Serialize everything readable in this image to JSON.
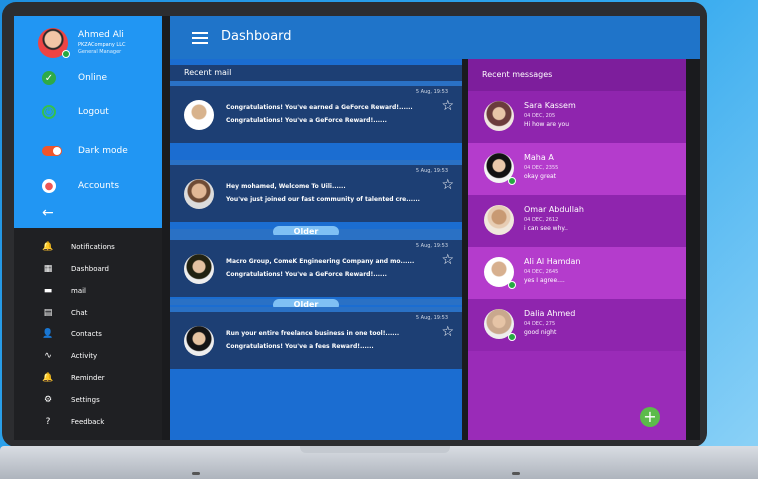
{
  "header": {
    "title": "Dashboard"
  },
  "user": {
    "name": "Ahmed Ali",
    "company": "PKZACompany LLC",
    "role": "General Manager"
  },
  "top_menu": [
    {
      "label": "Online",
      "icon": "check-circle-icon"
    },
    {
      "label": "Logout",
      "icon": "power-icon"
    },
    {
      "label": "Dark mode",
      "icon": "toggle-icon"
    },
    {
      "label": "Accounts",
      "icon": "account-icon"
    }
  ],
  "nav": [
    {
      "label": "Notifications",
      "icon": "bell-icon",
      "glyph": "🔔"
    },
    {
      "label": "Dashboard",
      "icon": "grid-icon",
      "glyph": "▦"
    },
    {
      "label": "mail",
      "icon": "mail-icon",
      "glyph": "▬"
    },
    {
      "label": "Chat",
      "icon": "chat-icon",
      "glyph": "▤"
    },
    {
      "label": "Contacts",
      "icon": "contacts-icon",
      "glyph": "👤"
    },
    {
      "label": "Activity",
      "icon": "activity-icon",
      "glyph": "∿"
    },
    {
      "label": "Reminder",
      "icon": "reminder-icon",
      "glyph": "🔔"
    },
    {
      "label": "Settings",
      "icon": "gear-icon",
      "glyph": "⚙"
    },
    {
      "label": "Feedback",
      "icon": "help-icon",
      "glyph": "?"
    }
  ],
  "mail": {
    "section_title": "Recent mail",
    "older_label": "Older",
    "items": [
      {
        "time": "5 Aug, 19:53",
        "line1": "Congratulations! You've earned a GeForce Reward!......",
        "line2": "Congratulations! You've  a GeForce Reward!......"
      },
      {
        "time": "5 Aug, 19:53",
        "line1": "Hey mohamed, Welcome To Uili......",
        "line2": "You've just joined our fast community of talented cre......"
      },
      {
        "time": "5 Aug, 19:53",
        "line1": "Macro Group, ComeK Engineering Company and mo......",
        "line2": "Congratulations! You've  a GeForce Reward!......"
      },
      {
        "time": "5 Aug, 19:53",
        "line1": "Run your entire freelance business in one tool!......",
        "line2": "Congratulations! You've  a fees Reward!......"
      }
    ]
  },
  "messages": {
    "section_title": "Recent messages",
    "items": [
      {
        "name": "Sara Kassem",
        "date": "04 DEC, 205",
        "preview": "Hi how are you"
      },
      {
        "name": "Maha A",
        "date": "04 DEC, 2355",
        "preview": "okay great"
      },
      {
        "name": "Omar Abdullah",
        "date": "04 DEC, 2612",
        "preview": "i can see why.."
      },
      {
        "name": "Ali Al Hamdan",
        "date": "04 DEC, 2645",
        "preview": "yes I agree...."
      },
      {
        "name": "Dalia Ahmed",
        "date": "04 DEC, 275",
        "preview": "good night"
      }
    ],
    "fab_label": "+"
  }
}
